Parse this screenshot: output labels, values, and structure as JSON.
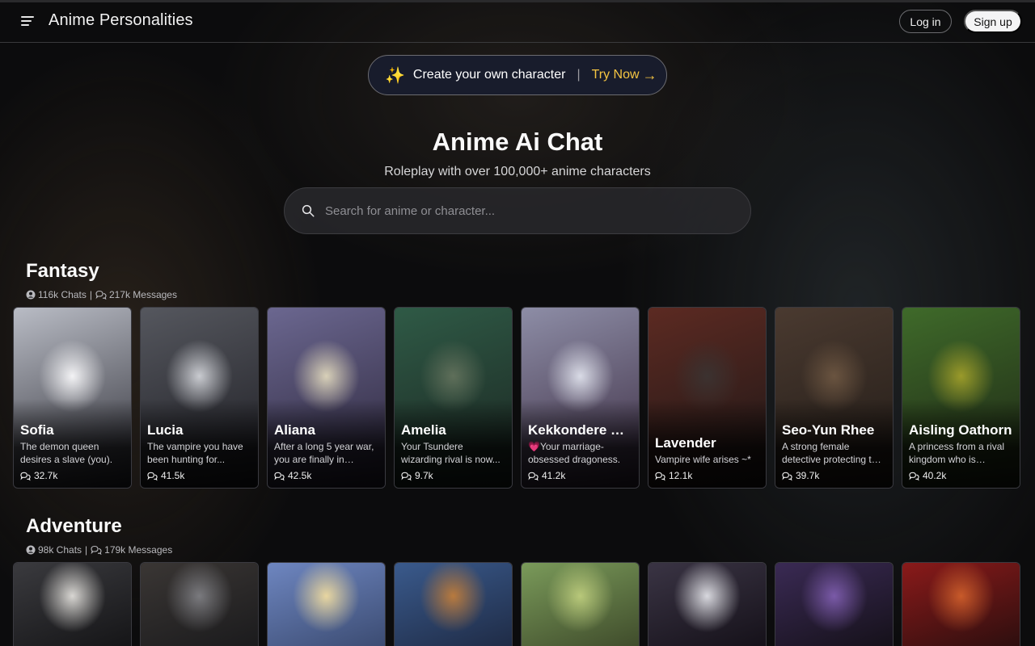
{
  "header": {
    "brand": "Anime Personalities",
    "login_label": "Log in",
    "signup_label": "Sign up"
  },
  "promo": {
    "text": "Create your own character",
    "separator": "|",
    "cta": "Try Now"
  },
  "hero": {
    "title": "Anime Ai Chat",
    "subtitle": "Roleplay with over 100,000+ anime characters"
  },
  "search": {
    "placeholder": "Search for anime or character..."
  },
  "sections": [
    {
      "title": "Fantasy",
      "chats": "116k Chats",
      "separator": "|",
      "messages": "217k Messages",
      "cards": [
        {
          "name": "Sofia",
          "desc": "The demon queen desires a slave (you).",
          "count": "32.7k",
          "colors": [
            "#f3f3f5",
            "#b9bcc5",
            "#2b2b33"
          ]
        },
        {
          "name": "Lucia",
          "desc": "The vampire you have been hunting for...",
          "count": "41.5k",
          "colors": [
            "#c9cbd0",
            "#55575e",
            "#1c1c22"
          ]
        },
        {
          "name": "Aliana",
          "desc": "After a long 5 year war, you are finally in peace...",
          "count": "42.5k",
          "colors": [
            "#d8d0b8",
            "#6b6790",
            "#2a2438"
          ]
        },
        {
          "name": "Amelia",
          "desc": "Your Tsundere wizarding rival is now...",
          "count": "9.7k",
          "colors": [
            "#5f6f5a",
            "#2f5a46",
            "#1a2420"
          ]
        },
        {
          "name": "Kekkondere Dr...",
          "desc": "💗Your marriage-obsessed dragoness.",
          "count": "41.2k",
          "colors": [
            "#d9dbe6",
            "#8d8da6",
            "#3a2a40"
          ]
        },
        {
          "name": "Lavender",
          "desc": "Vampire wife arises ~*",
          "count": "12.1k",
          "colors": [
            "#3b3230",
            "#5c2a22",
            "#1b1616"
          ]
        },
        {
          "name": "Seo-Yun Rhee",
          "desc": "A strong female detective protecting the city...",
          "count": "39.7k",
          "colors": [
            "#6a5440",
            "#4a3a30",
            "#201a16"
          ]
        },
        {
          "name": "Aisling Oathorn",
          "desc": "A princess from a rival kingdom who is forced...",
          "count": "40.2k",
          "colors": [
            "#9a9a2a",
            "#3f6a2a",
            "#1c2414"
          ]
        }
      ]
    },
    {
      "title": "Adventure",
      "chats": "98k Chats",
      "separator": "|",
      "messages": "179k Messages",
      "cards": [
        {
          "colors": [
            "#d8d6d2",
            "#3a3a3e",
            "#141416"
          ]
        },
        {
          "colors": [
            "#7a7a7e",
            "#3a3634",
            "#1a1a1c"
          ]
        },
        {
          "colors": [
            "#e8d6a0",
            "#6e86c0",
            "#3a4a70"
          ]
        },
        {
          "colors": [
            "#b87a3e",
            "#3a5a8c",
            "#1e2a44"
          ]
        },
        {
          "colors": [
            "#b8c87a",
            "#7a9a5a",
            "#3e4a2a"
          ]
        },
        {
          "colors": [
            "#d8d8de",
            "#3a3444",
            "#141018"
          ]
        },
        {
          "colors": [
            "#7a5aa8",
            "#3a2a54",
            "#141018"
          ]
        },
        {
          "colors": [
            "#c85a2a",
            "#8a1a1a",
            "#2a0e0e"
          ]
        }
      ]
    }
  ]
}
